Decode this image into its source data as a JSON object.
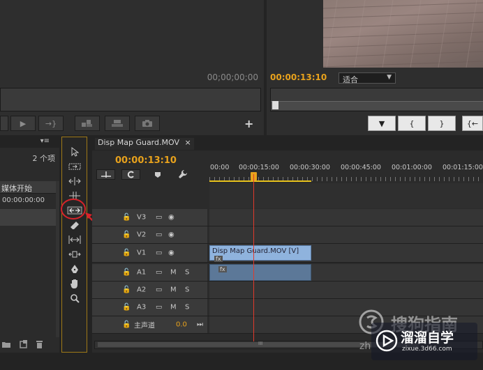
{
  "source_monitor": {
    "timecode": "00;00;00;00",
    "buttons": [
      "▶",
      "→}",
      "",
      "",
      "",
      "+"
    ]
  },
  "program_monitor": {
    "timecode": "00:00:13:10",
    "fit_label": "适合",
    "buttons": [
      "▼",
      "{",
      "}",
      "{←"
    ]
  },
  "project": {
    "tab_menu": "▾≡",
    "item_count": "2 个项",
    "column_header": "媒体开始",
    "row_time": "00:00:00:00"
  },
  "timeline": {
    "tab_label": "Disp Map Guard.MOV",
    "tab_close": "×",
    "timecode": "00:00:13:10",
    "ruler_ticks": [
      "00:00",
      "00:00:15:00",
      "00:00:30:00",
      "00:00:45:00",
      "00:01:00:00",
      "00:01:15:00"
    ],
    "video_tracks": [
      {
        "name": "V3"
      },
      {
        "name": "V2"
      },
      {
        "name": "V1"
      }
    ],
    "audio_tracks": [
      {
        "name": "A1",
        "m": "M",
        "s": "S"
      },
      {
        "name": "A2",
        "m": "M",
        "s": "S"
      },
      {
        "name": "A3",
        "m": "M",
        "s": "S"
      }
    ],
    "master": {
      "name": "主声道",
      "value": "0.0"
    },
    "video_clip_label": "Disp Map Guard.MOV [V]",
    "fx_badge": "fx",
    "scroll_label": "III"
  },
  "watermarks": {
    "sogou": "搜狗指南",
    "site": "溜溜自学",
    "url": "zixue.3d66.com",
    "zh": "zh"
  },
  "colors": {
    "accent_orange": "#e8a21c",
    "playhead_red": "#e03a2c",
    "video_clip": "#8fb3dd",
    "audio_clip": "#5c7898",
    "annotation_red": "#d8232a"
  }
}
